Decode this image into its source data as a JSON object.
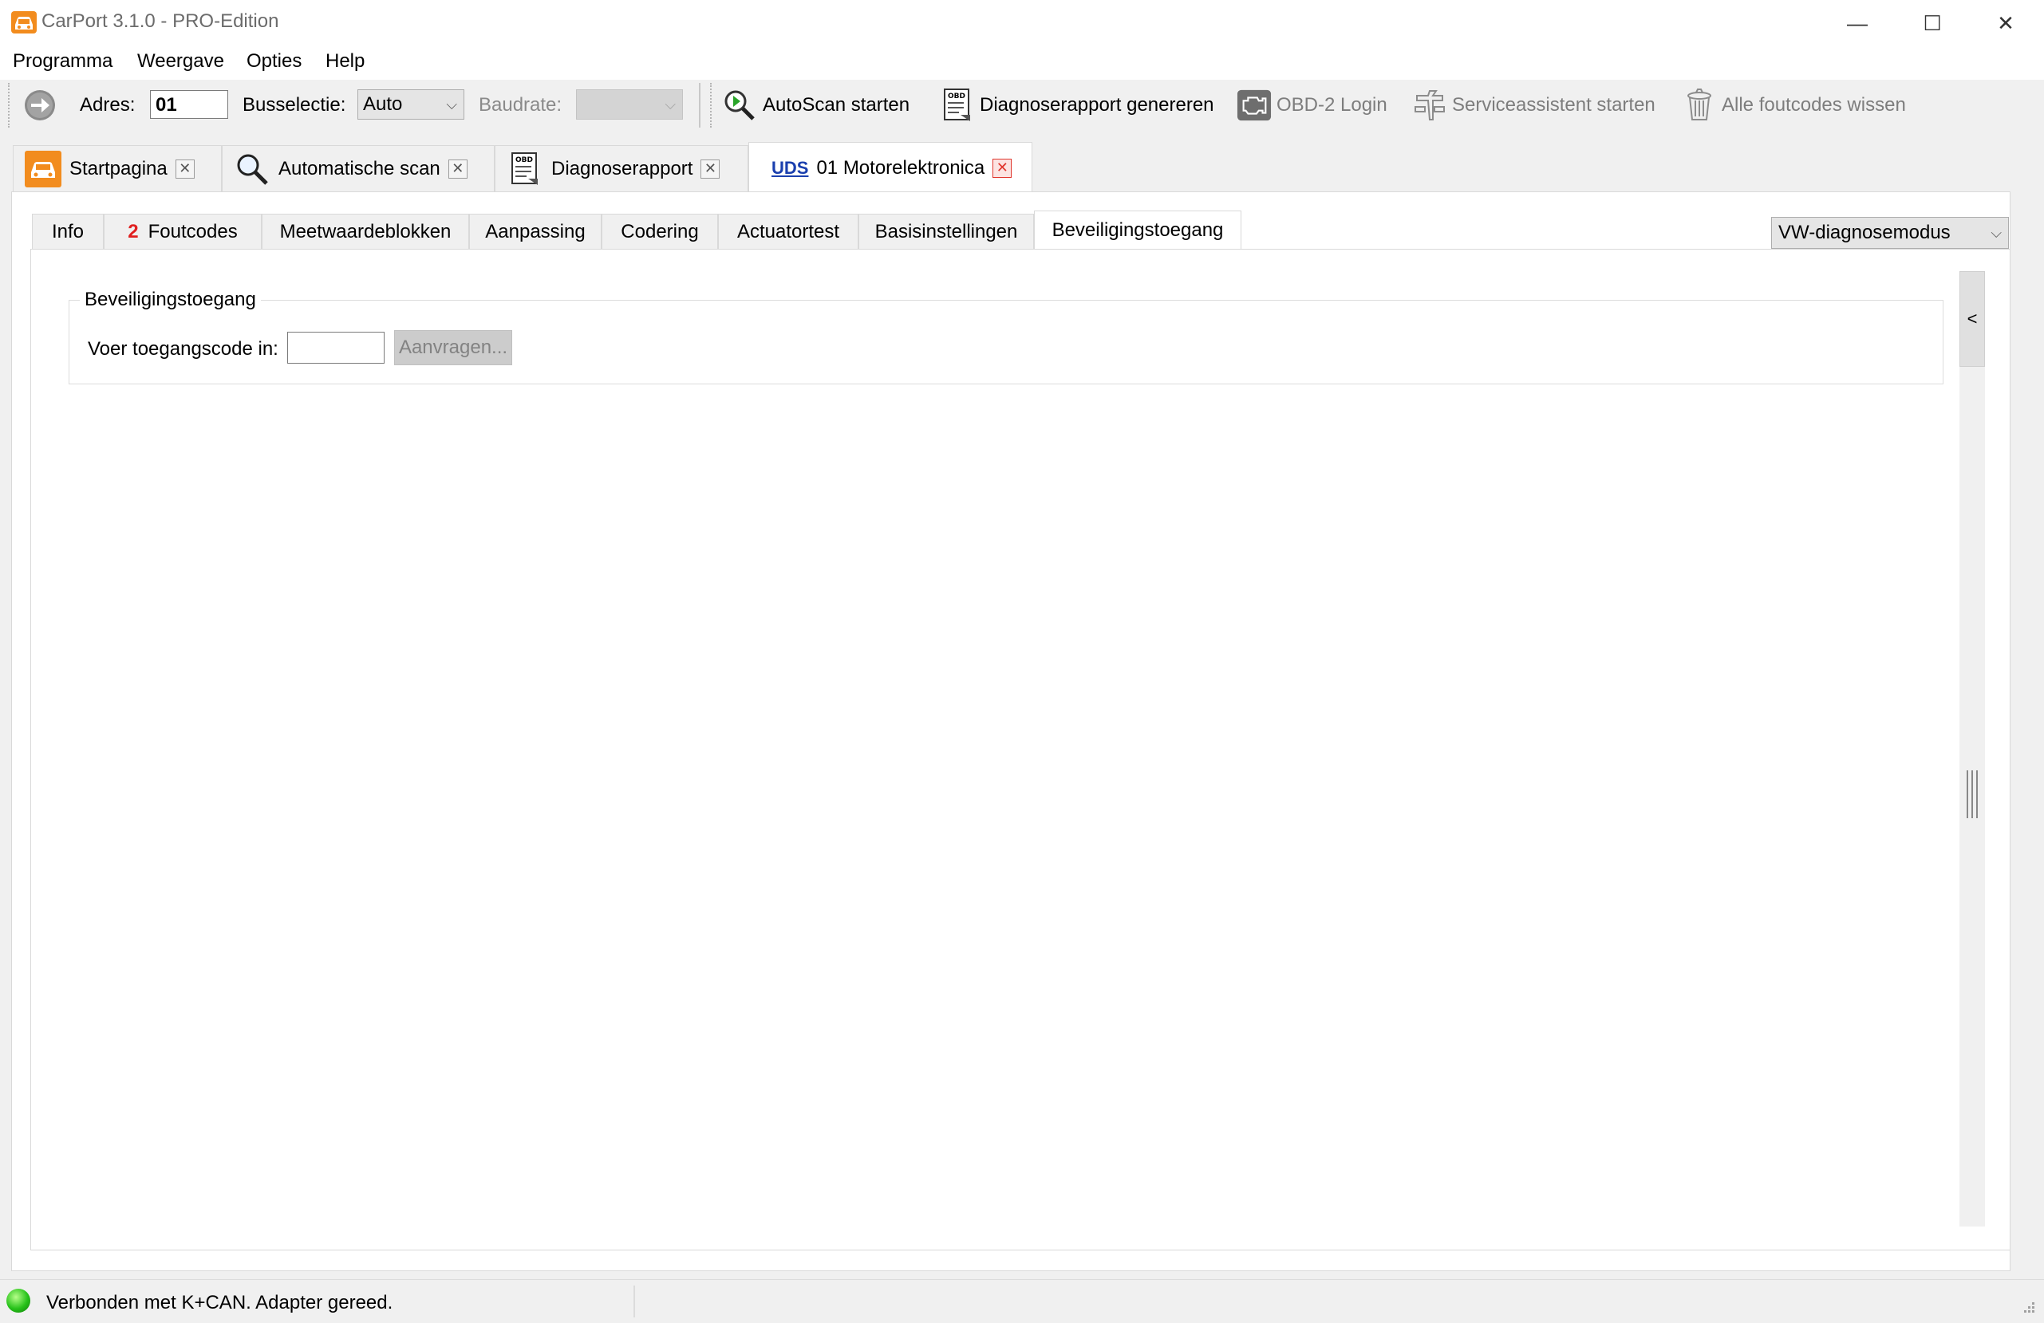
{
  "window": {
    "title": "CarPort 3.1.0 - PRO-Edition",
    "minimize": "—",
    "maximize": "☐",
    "close": "✕"
  },
  "menu": [
    "Programma",
    "Weergave",
    "Opties",
    "Help"
  ],
  "toolbar": {
    "address_label": "Adres:",
    "address_value": "01",
    "bus_label": "Busselectie:",
    "bus_value": "Auto",
    "baud_label": "Baudrate:",
    "baud_value": "",
    "buttons": [
      {
        "label": "AutoScan starten",
        "icon": "autoscan-icon",
        "enabled": true
      },
      {
        "label": "Diagnoserapport genereren",
        "icon": "obd-report-icon",
        "enabled": true
      },
      {
        "label": "OBD-2 Login",
        "icon": "engine-icon",
        "enabled": false
      },
      {
        "label": "Serviceassistent starten",
        "icon": "wrench-icon",
        "enabled": false
      },
      {
        "label": "Alle foutcodes wissen",
        "icon": "trash-icon",
        "enabled": false
      }
    ]
  },
  "doc_tabs": [
    {
      "label": "Startpagina",
      "icon": "car-icon"
    },
    {
      "label": "Automatische scan",
      "icon": "magnifier-icon"
    },
    {
      "label": "Diagnoserapport",
      "icon": "obd-report-icon"
    },
    {
      "label": "01 Motorelektronica",
      "prefix": "UDS",
      "active": true
    }
  ],
  "sub_tabs": [
    {
      "label": "Info"
    },
    {
      "label": "Foutcodes",
      "count": "2"
    },
    {
      "label": "Meetwaardeblokken"
    },
    {
      "label": "Aanpassing"
    },
    {
      "label": "Codering"
    },
    {
      "label": "Actuatortest"
    },
    {
      "label": "Basisinstellingen"
    },
    {
      "label": "Beveiligingstoegang",
      "active": true
    }
  ],
  "mode_select": "VW-diagnosemodus",
  "security": {
    "group_title": "Beveiligingstoegang",
    "code_label": "Voer toegangscode in:",
    "code_value": "",
    "request_button": "Aanvragen..."
  },
  "collapse_label": "<",
  "status": {
    "text": "Verbonden met K+CAN. Adapter gereed.",
    "led_color": "#27c21a"
  }
}
